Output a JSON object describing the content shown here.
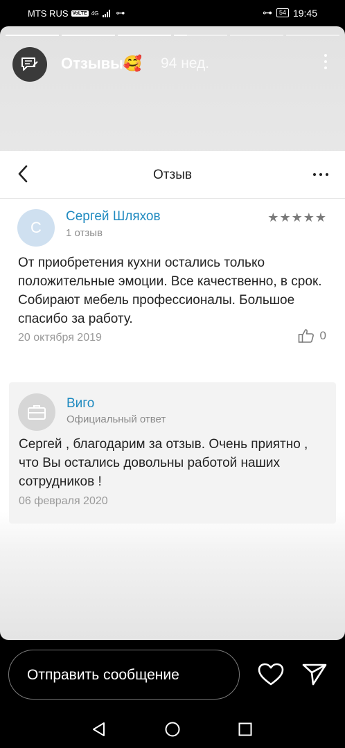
{
  "status_bar": {
    "carrier": "MTS RUS",
    "volte": "VoLTE",
    "network": "4G",
    "battery": "54",
    "time": "19:45"
  },
  "story": {
    "title": "Отзывы🥰",
    "time_ago": "94 нед.",
    "progress_segments": 6,
    "progress_filled": 3
  },
  "review_screen": {
    "title": "Отзыв",
    "review": {
      "avatar_letter": "С",
      "author": "Сергей Шляхов",
      "reviews_count": "1 отзыв",
      "rating": 5,
      "text": "От приобретения кухни остались только положительные эмоции. Все качественно, в срок. Собирают мебель профессионалы. Большое спасибо за работу.",
      "date": "20 октября 2019",
      "likes": "0"
    },
    "answer": {
      "company": "Виго",
      "role": "Официальный ответ",
      "text": "Сергей , благодарим за отзыв. Очень приятно , что Вы остались довольны работой наших сотрудников !",
      "date": "06 февраля 2020"
    }
  },
  "message_bar": {
    "placeholder": "Отправить сообщение"
  },
  "colors": {
    "link_blue": "#1f8ac0",
    "muted_gray": "#8a8a8a",
    "avatar_light_blue": "#cfe0f0"
  }
}
